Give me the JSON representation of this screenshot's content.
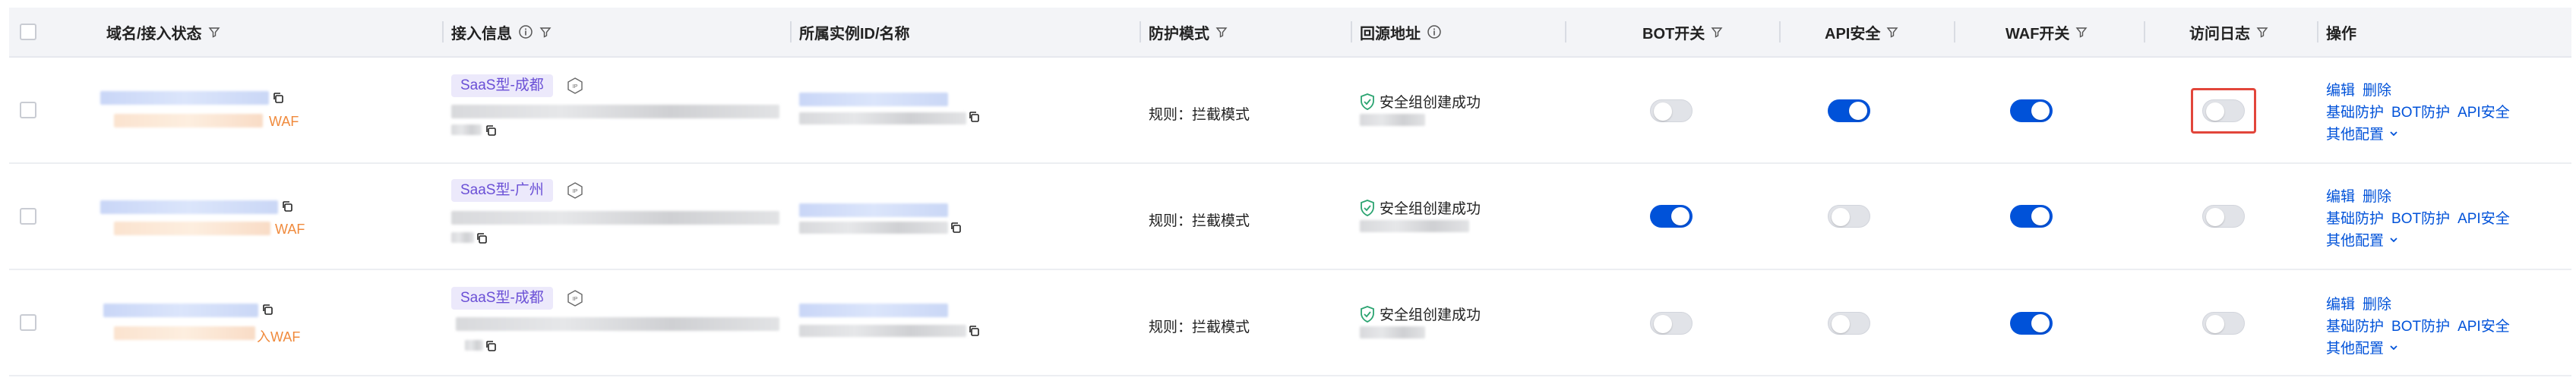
{
  "headers": {
    "domain": "域名/接入状态",
    "access": "接入信息",
    "instance": "所属实例ID/名称",
    "mode": "防护模式",
    "origin": "回源地址",
    "bot": "BOT开关",
    "api": "API安全",
    "waf": "WAF开关",
    "log": "访问日志",
    "ops": "操作"
  },
  "rows": [
    {
      "waf_suffix": "WAF",
      "region": "SaaS型-成都",
      "mode": "规则：拦截模式",
      "origin_status": "安全组创建成功",
      "bot": false,
      "api": true,
      "waf": true,
      "log": false,
      "edit": "编辑",
      "delete": "删除",
      "basic": "基础防护",
      "botp": "BOT防护",
      "apisec": "API安全",
      "more": "其他配置"
    },
    {
      "waf_suffix": "WAF",
      "region": "SaaS型-广州",
      "mode": "规则：拦截模式",
      "origin_status": "安全组创建成功",
      "bot": true,
      "api": false,
      "waf": true,
      "log": false,
      "edit": "编辑",
      "delete": "删除",
      "basic": "基础防护",
      "botp": "BOT防护",
      "apisec": "API安全",
      "more": "其他配置"
    },
    {
      "waf_suffix": "入WAF",
      "region": "SaaS型-成都",
      "mode": "规则：拦截模式",
      "origin_status": "安全组创建成功",
      "bot": false,
      "api": false,
      "waf": true,
      "log": false,
      "edit": "编辑",
      "delete": "删除",
      "basic": "基础防护",
      "botp": "BOT防护",
      "apisec": "API安全",
      "more": "其他配置"
    }
  ],
  "colors": {
    "accent": "#0052d9",
    "highlight": "#e2463b",
    "waf_tag": "#f08a3c",
    "region_pill": "#6a4fd6"
  },
  "icons": [
    "filter-icon",
    "info-icon",
    "copy-icon",
    "ipv6-icon",
    "shield-check-icon",
    "chevron-down-icon"
  ]
}
